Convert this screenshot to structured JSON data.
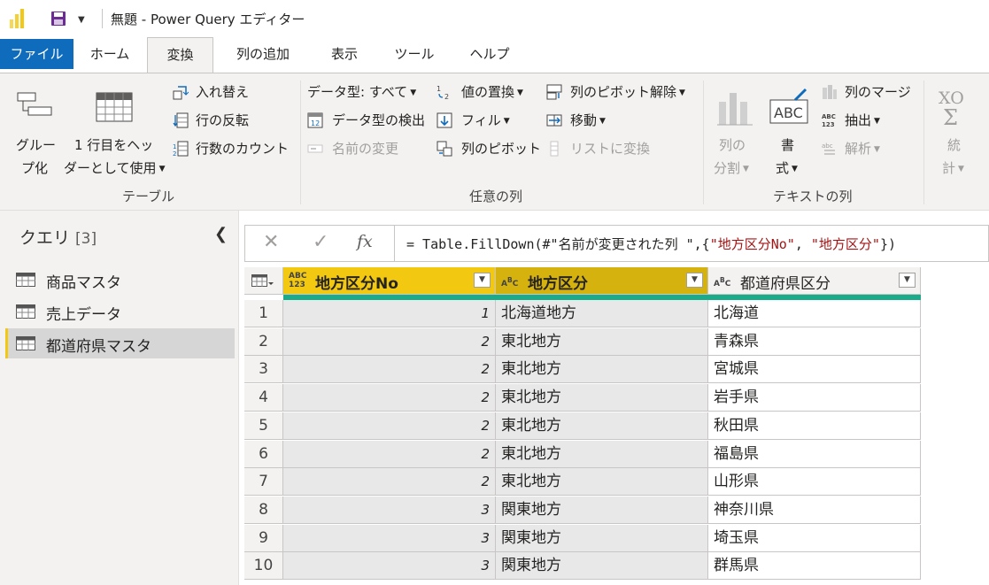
{
  "window": {
    "title": "無題 - Power Query エディター",
    "accent_color": "#f2c811"
  },
  "tabs": [
    {
      "label": "ファイル"
    },
    {
      "label": "ホーム"
    },
    {
      "label": "変換"
    },
    {
      "label": "列の追加"
    },
    {
      "label": "表示"
    },
    {
      "label": "ツール"
    },
    {
      "label": "ヘルプ"
    }
  ],
  "ribbon": {
    "table_group": {
      "label": "テーブル",
      "group_by": {
        "line1": "グルー",
        "line2": "プ化"
      },
      "use_first_row": {
        "line1": "1 行目をヘッ",
        "line2": "ダーとして使用"
      },
      "transpose": "入れ替え",
      "reverse_rows": "行の反転",
      "count_rows": "行数のカウント"
    },
    "any_column_group": {
      "label": "任意の列",
      "data_type": "データ型: すべて",
      "detect_type": "データ型の検出",
      "rename": "名前の変更",
      "replace_values": "値の置換",
      "fill": "フィル",
      "pivot": "列のピボット",
      "unpivot": "列のピボット解除",
      "move": "移動",
      "convert_to_list": "リストに変換"
    },
    "text_group": {
      "label": "テキストの列",
      "split": {
        "line1": "列の",
        "line2": "分割"
      },
      "format": {
        "line1": "書",
        "line2": "式"
      },
      "merge": "列のマージ",
      "extract": "抽出",
      "parse": "解析"
    },
    "number_group": {
      "stats": {
        "line1": "統",
        "line2": "計"
      }
    }
  },
  "queries": {
    "title": "クエリ",
    "count": "[3]",
    "items": [
      {
        "label": "商品マスタ"
      },
      {
        "label": "売上データ"
      },
      {
        "label": "都道府県マスタ"
      }
    ]
  },
  "formula": {
    "prefix": "= Table.FillDown(#\"名前が変更された列 \",{",
    "str1": "\"地方区分No\"",
    "mid": ", ",
    "str2": "\"地方区分\"",
    "suffix": "})"
  },
  "grid": {
    "columns": [
      {
        "name": "地方区分No",
        "type": "ABC 123",
        "color": "#f2c811"
      },
      {
        "name": "地方区分",
        "type": "ABC",
        "color": "#d6b20f"
      },
      {
        "name": "都道府県区分",
        "type": "ABC",
        "color": "#f3f2f1"
      }
    ],
    "rows": [
      {
        "idx": "1",
        "no": "1",
        "region": "北海道地方",
        "pref": "北海道"
      },
      {
        "idx": "2",
        "no": "2",
        "region": "東北地方",
        "pref": "青森県"
      },
      {
        "idx": "3",
        "no": "2",
        "region": "東北地方",
        "pref": "宮城県"
      },
      {
        "idx": "4",
        "no": "2",
        "region": "東北地方",
        "pref": "岩手県"
      },
      {
        "idx": "5",
        "no": "2",
        "region": "東北地方",
        "pref": "秋田県"
      },
      {
        "idx": "6",
        "no": "2",
        "region": "東北地方",
        "pref": "福島県"
      },
      {
        "idx": "7",
        "no": "2",
        "region": "東北地方",
        "pref": "山形県"
      },
      {
        "idx": "8",
        "no": "3",
        "region": "関東地方",
        "pref": "神奈川県"
      },
      {
        "idx": "9",
        "no": "3",
        "region": "関東地方",
        "pref": "埼玉県"
      },
      {
        "idx": "10",
        "no": "3",
        "region": "関東地方",
        "pref": "群馬県"
      }
    ]
  }
}
